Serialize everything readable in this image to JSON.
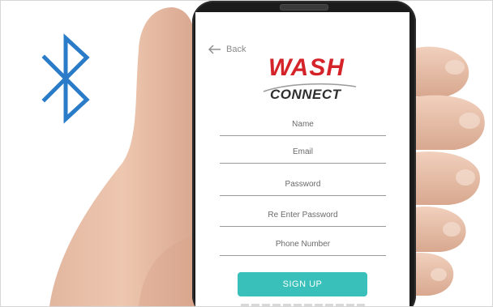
{
  "icons": {
    "bluetooth": "bluetooth-icon",
    "back": "arrow-left-icon"
  },
  "colors": {
    "bluetooth": "#2b7cc8",
    "brand_red": "#d5232a",
    "button": "#39c0ba"
  },
  "header": {
    "back_label": "Back"
  },
  "logo": {
    "line1": "WASH",
    "line2": "CONNECT"
  },
  "form": {
    "name_placeholder": "Name",
    "email_placeholder": "Email",
    "password_placeholder": "Password",
    "reenter_placeholder": "Re Enter Password",
    "phone_placeholder": "Phone Number",
    "signup_label": "SIGN UP"
  }
}
